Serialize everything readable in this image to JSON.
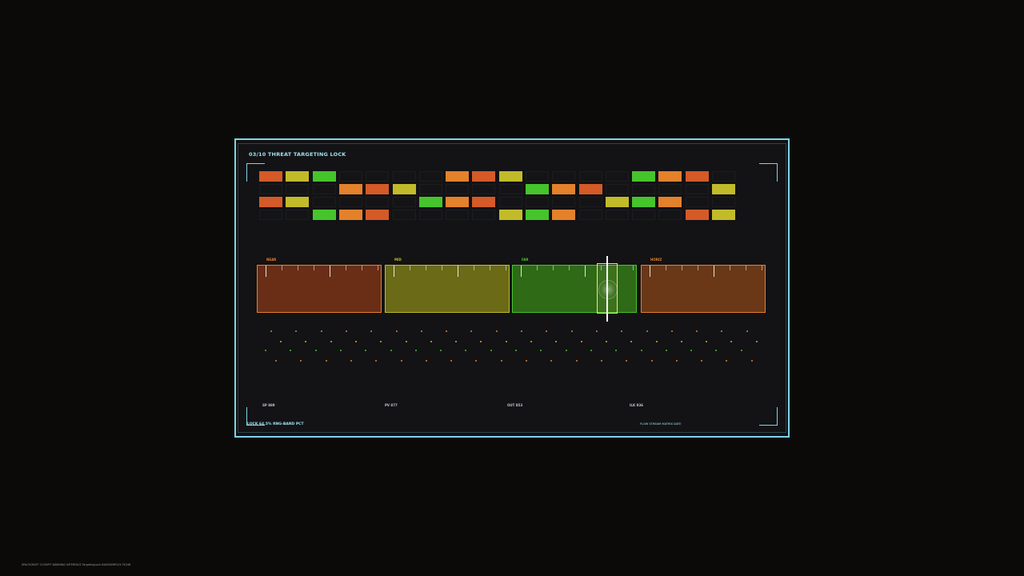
{
  "panel": {
    "title": "03/10  THREAT TARGETING LOCK",
    "accent": "#7fd3e6"
  },
  "grid": {
    "rows": [
      [
        "red",
        "lime",
        "green",
        "off",
        "off",
        "off",
        "off",
        "orange",
        "red",
        "lime",
        "off",
        "off",
        "off",
        "off",
        "green",
        "orange",
        "red",
        "off"
      ],
      [
        "off",
        "off",
        "off",
        "orange",
        "red",
        "lime",
        "off",
        "off",
        "off",
        "off",
        "green",
        "orange",
        "red",
        "off",
        "off",
        "off",
        "off",
        "lime"
      ],
      [
        "red",
        "lime",
        "off",
        "off",
        "off",
        "off",
        "green",
        "orange",
        "red",
        "off",
        "off",
        "off",
        "off",
        "lime",
        "green",
        "orange",
        "off",
        "off"
      ],
      [
        "off",
        "off",
        "green",
        "orange",
        "red",
        "off",
        "off",
        "off",
        "off",
        "lime",
        "green",
        "orange",
        "off",
        "off",
        "off",
        "off",
        "red",
        "lime"
      ]
    ],
    "colors": {
      "orange": "#e4812b",
      "red": "#d45a28",
      "lime": "#c1bb2a",
      "green": "#46c42c"
    }
  },
  "bands": [
    {
      "label": "NEAR",
      "label_color": "#e4812b",
      "fill": "#6a2e17",
      "border": "#e4812b"
    },
    {
      "label": "MID",
      "label_color": "#c1bb2a",
      "fill": "#6a6a17",
      "border": "#c1bb2a"
    },
    {
      "label": "FAR",
      "label_color": "#46c42c",
      "fill": "#2f6a17",
      "border": "#46c42c"
    },
    {
      "label": "HORIZ",
      "label_color": "#e4812b",
      "fill": "#6a3817",
      "border": "#e4812b"
    }
  ],
  "readouts": [
    {
      "label": "SP 889"
    },
    {
      "label": "PV 877"
    },
    {
      "label": "OUT 853"
    },
    {
      "label": "ILK 936"
    }
  ],
  "footer": {
    "left": "LOCK 64.5%  RNG-BAND PCT",
    "right": "FLOW STREAM  MATRIX DATE"
  },
  "page_caption": "SPACECRAFT COCKPIT WARNING INTERFACE  TargetingLock  BASISSIMPLEX  FE248"
}
